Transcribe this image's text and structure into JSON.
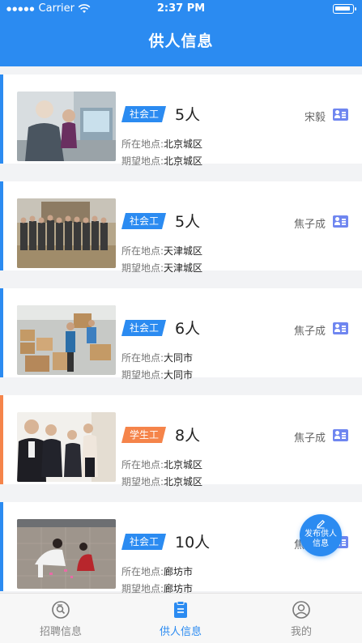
{
  "status_bar": {
    "carrier": "Carrier",
    "time": "2:37 PM"
  },
  "header": {
    "title": "供人信息"
  },
  "colors": {
    "primary": "#2b8bf1",
    "social_worker": "#2b8bf1",
    "student_worker": "#f5844a"
  },
  "labels": {
    "location": "所在地点:",
    "desired": "期望地点:"
  },
  "cards": [
    {
      "tag": "社会工",
      "tag_type": "social",
      "count": "5人",
      "poster": "宋毅",
      "location": "北京城区",
      "desired": "北京城区",
      "photo": "elderly-man-at-counter"
    },
    {
      "tag": "社会工",
      "tag_type": "social",
      "count": "5人",
      "poster": "焦子成",
      "location": "天津城区",
      "desired": "天津城区",
      "photo": "group-of-workers-outdoors"
    },
    {
      "tag": "社会工",
      "tag_type": "social",
      "count": "6人",
      "poster": "焦子成",
      "location": "大同市",
      "desired": "大同市",
      "photo": "warehouse-boxes"
    },
    {
      "tag": "学生工",
      "tag_type": "student",
      "count": "8人",
      "poster": "焦子成",
      "location": "北京城区",
      "desired": "北京城区",
      "photo": "students-in-suits"
    },
    {
      "tag": "社会工",
      "tag_type": "social",
      "count": "10人",
      "poster": "焦子成",
      "location": "廊坊市",
      "desired": "廊坊市",
      "photo": "children-on-pavement"
    }
  ],
  "fab": {
    "line1": "发布供人",
    "line2": "信息",
    "icon": "pen-icon"
  },
  "tabs": [
    {
      "label": "招聘信息",
      "icon": "recruit-icon",
      "active": false
    },
    {
      "label": "供人信息",
      "icon": "clipboard-icon",
      "active": true
    },
    {
      "label": "我的",
      "icon": "user-icon",
      "active": false
    }
  ]
}
